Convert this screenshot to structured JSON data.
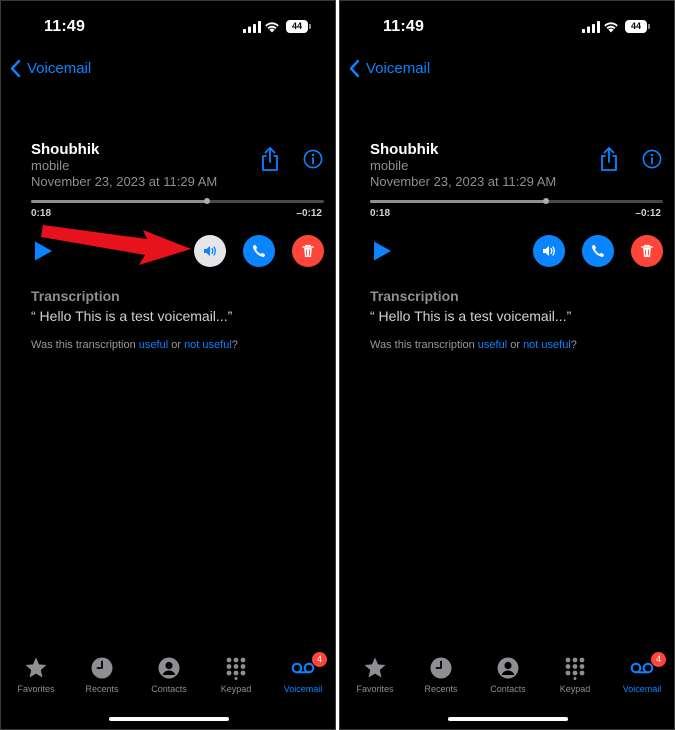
{
  "status": {
    "time": "11:49",
    "battery": "44"
  },
  "nav": {
    "back_label": "Voicemail"
  },
  "voicemail": {
    "caller": "Shoubhik",
    "type": "mobile",
    "date": "November 23, 2023 at 11:29 AM",
    "elapsed": "0:18",
    "remaining": "–0:12",
    "progress": 0.6
  },
  "transcription": {
    "heading": "Transcription",
    "text": "“ Hello This is a test voicemail...”",
    "feedback_prefix": "Was this transcription ",
    "useful": "useful",
    "or": " or ",
    "not_useful": "not useful",
    "suffix": "?"
  },
  "tabs": [
    {
      "label": "Favorites"
    },
    {
      "label": "Recents"
    },
    {
      "label": "Contacts"
    },
    {
      "label": "Keypad"
    },
    {
      "label": "Voicemail",
      "badge": "4"
    }
  ],
  "colors": {
    "accent": "#0a84ff",
    "destructive": "#ff453a",
    "annotation_arrow": "#e8121c",
    "speaker_active": "#e5e5ea"
  },
  "icons": [
    "chevron-left-icon",
    "share-icon",
    "info-icon",
    "play-icon",
    "speaker-icon",
    "phone-icon",
    "trash-icon",
    "star-icon",
    "clock-icon",
    "person-icon",
    "keypad-icon",
    "voicemail-icon",
    "signal-icon",
    "wifi-icon"
  ]
}
